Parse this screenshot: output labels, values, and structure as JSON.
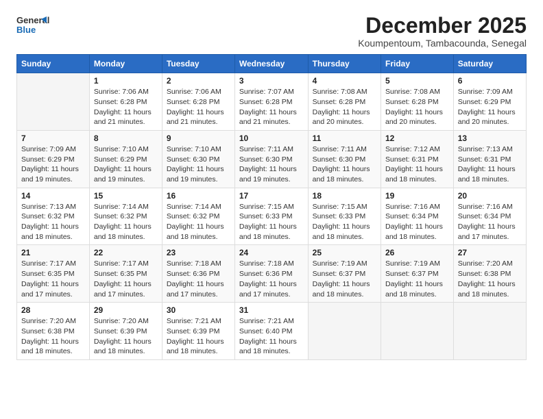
{
  "header": {
    "logo_line1": "General",
    "logo_line2": "Blue",
    "month": "December 2025",
    "location": "Koumpentoum, Tambacounda, Senegal"
  },
  "columns": [
    "Sunday",
    "Monday",
    "Tuesday",
    "Wednesday",
    "Thursday",
    "Friday",
    "Saturday"
  ],
  "weeks": [
    [
      {
        "day": "",
        "sunrise": "",
        "sunset": "",
        "daylight": ""
      },
      {
        "day": "1",
        "sunrise": "Sunrise: 7:06 AM",
        "sunset": "Sunset: 6:28 PM",
        "daylight": "Daylight: 11 hours and 21 minutes."
      },
      {
        "day": "2",
        "sunrise": "Sunrise: 7:06 AM",
        "sunset": "Sunset: 6:28 PM",
        "daylight": "Daylight: 11 hours and 21 minutes."
      },
      {
        "day": "3",
        "sunrise": "Sunrise: 7:07 AM",
        "sunset": "Sunset: 6:28 PM",
        "daylight": "Daylight: 11 hours and 21 minutes."
      },
      {
        "day": "4",
        "sunrise": "Sunrise: 7:08 AM",
        "sunset": "Sunset: 6:28 PM",
        "daylight": "Daylight: 11 hours and 20 minutes."
      },
      {
        "day": "5",
        "sunrise": "Sunrise: 7:08 AM",
        "sunset": "Sunset: 6:28 PM",
        "daylight": "Daylight: 11 hours and 20 minutes."
      },
      {
        "day": "6",
        "sunrise": "Sunrise: 7:09 AM",
        "sunset": "Sunset: 6:29 PM",
        "daylight": "Daylight: 11 hours and 20 minutes."
      }
    ],
    [
      {
        "day": "7",
        "sunrise": "Sunrise: 7:09 AM",
        "sunset": "Sunset: 6:29 PM",
        "daylight": "Daylight: 11 hours and 19 minutes."
      },
      {
        "day": "8",
        "sunrise": "Sunrise: 7:10 AM",
        "sunset": "Sunset: 6:29 PM",
        "daylight": "Daylight: 11 hours and 19 minutes."
      },
      {
        "day": "9",
        "sunrise": "Sunrise: 7:10 AM",
        "sunset": "Sunset: 6:30 PM",
        "daylight": "Daylight: 11 hours and 19 minutes."
      },
      {
        "day": "10",
        "sunrise": "Sunrise: 7:11 AM",
        "sunset": "Sunset: 6:30 PM",
        "daylight": "Daylight: 11 hours and 19 minutes."
      },
      {
        "day": "11",
        "sunrise": "Sunrise: 7:11 AM",
        "sunset": "Sunset: 6:30 PM",
        "daylight": "Daylight: 11 hours and 18 minutes."
      },
      {
        "day": "12",
        "sunrise": "Sunrise: 7:12 AM",
        "sunset": "Sunset: 6:31 PM",
        "daylight": "Daylight: 11 hours and 18 minutes."
      },
      {
        "day": "13",
        "sunrise": "Sunrise: 7:13 AM",
        "sunset": "Sunset: 6:31 PM",
        "daylight": "Daylight: 11 hours and 18 minutes."
      }
    ],
    [
      {
        "day": "14",
        "sunrise": "Sunrise: 7:13 AM",
        "sunset": "Sunset: 6:32 PM",
        "daylight": "Daylight: 11 hours and 18 minutes."
      },
      {
        "day": "15",
        "sunrise": "Sunrise: 7:14 AM",
        "sunset": "Sunset: 6:32 PM",
        "daylight": "Daylight: 11 hours and 18 minutes."
      },
      {
        "day": "16",
        "sunrise": "Sunrise: 7:14 AM",
        "sunset": "Sunset: 6:32 PM",
        "daylight": "Daylight: 11 hours and 18 minutes."
      },
      {
        "day": "17",
        "sunrise": "Sunrise: 7:15 AM",
        "sunset": "Sunset: 6:33 PM",
        "daylight": "Daylight: 11 hours and 18 minutes."
      },
      {
        "day": "18",
        "sunrise": "Sunrise: 7:15 AM",
        "sunset": "Sunset: 6:33 PM",
        "daylight": "Daylight: 11 hours and 18 minutes."
      },
      {
        "day": "19",
        "sunrise": "Sunrise: 7:16 AM",
        "sunset": "Sunset: 6:34 PM",
        "daylight": "Daylight: 11 hours and 18 minutes."
      },
      {
        "day": "20",
        "sunrise": "Sunrise: 7:16 AM",
        "sunset": "Sunset: 6:34 PM",
        "daylight": "Daylight: 11 hours and 17 minutes."
      }
    ],
    [
      {
        "day": "21",
        "sunrise": "Sunrise: 7:17 AM",
        "sunset": "Sunset: 6:35 PM",
        "daylight": "Daylight: 11 hours and 17 minutes."
      },
      {
        "day": "22",
        "sunrise": "Sunrise: 7:17 AM",
        "sunset": "Sunset: 6:35 PM",
        "daylight": "Daylight: 11 hours and 17 minutes."
      },
      {
        "day": "23",
        "sunrise": "Sunrise: 7:18 AM",
        "sunset": "Sunset: 6:36 PM",
        "daylight": "Daylight: 11 hours and 17 minutes."
      },
      {
        "day": "24",
        "sunrise": "Sunrise: 7:18 AM",
        "sunset": "Sunset: 6:36 PM",
        "daylight": "Daylight: 11 hours and 17 minutes."
      },
      {
        "day": "25",
        "sunrise": "Sunrise: 7:19 AM",
        "sunset": "Sunset: 6:37 PM",
        "daylight": "Daylight: 11 hours and 18 minutes."
      },
      {
        "day": "26",
        "sunrise": "Sunrise: 7:19 AM",
        "sunset": "Sunset: 6:37 PM",
        "daylight": "Daylight: 11 hours and 18 minutes."
      },
      {
        "day": "27",
        "sunrise": "Sunrise: 7:20 AM",
        "sunset": "Sunset: 6:38 PM",
        "daylight": "Daylight: 11 hours and 18 minutes."
      }
    ],
    [
      {
        "day": "28",
        "sunrise": "Sunrise: 7:20 AM",
        "sunset": "Sunset: 6:38 PM",
        "daylight": "Daylight: 11 hours and 18 minutes."
      },
      {
        "day": "29",
        "sunrise": "Sunrise: 7:20 AM",
        "sunset": "Sunset: 6:39 PM",
        "daylight": "Daylight: 11 hours and 18 minutes."
      },
      {
        "day": "30",
        "sunrise": "Sunrise: 7:21 AM",
        "sunset": "Sunset: 6:39 PM",
        "daylight": "Daylight: 11 hours and 18 minutes."
      },
      {
        "day": "31",
        "sunrise": "Sunrise: 7:21 AM",
        "sunset": "Sunset: 6:40 PM",
        "daylight": "Daylight: 11 hours and 18 minutes."
      },
      {
        "day": "",
        "sunrise": "",
        "sunset": "",
        "daylight": ""
      },
      {
        "day": "",
        "sunrise": "",
        "sunset": "",
        "daylight": ""
      },
      {
        "day": "",
        "sunrise": "",
        "sunset": "",
        "daylight": ""
      }
    ]
  ]
}
